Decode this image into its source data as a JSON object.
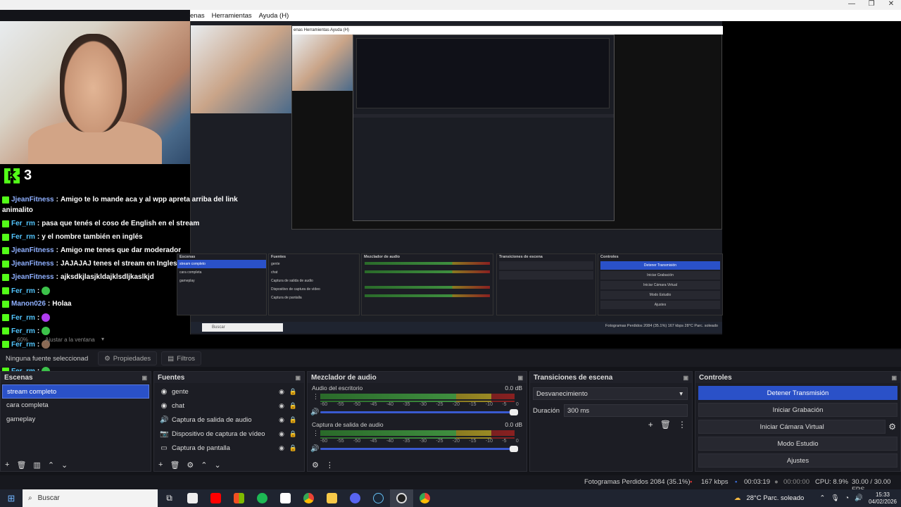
{
  "window": {
    "menu": [
      "enas",
      "Herramientas",
      "Ayuda (H)"
    ],
    "controls": [
      "—",
      "❐",
      "✕"
    ]
  },
  "chat": {
    "count": "3",
    "messages": [
      {
        "user": "JjeanFitness",
        "text": "Amigo te lo mande aca y al wpp apreta arriba del link",
        "cont": "animalito",
        "color": "#8fb0ff"
      },
      {
        "user": "Fer_rm",
        "text": "pasa que tenés el coso de English en el stream",
        "color": "#53c6ff"
      },
      {
        "user": "Fer_rm",
        "text": "y el nombre también en inglés",
        "color": "#53c6ff"
      },
      {
        "user": "JjeanFitness",
        "text": "Amigo me tenes que dar moderador",
        "color": "#8fb0ff"
      },
      {
        "user": "JjeanFitness",
        "text": "JAJAJAJ tenes el stream en Ingles",
        "color": "#8fb0ff"
      },
      {
        "user": "JjeanFitness",
        "text": "ajksdkjlasjkldajklsdljkaslkjd",
        "color": "#8fb0ff"
      },
      {
        "user": "Fer_rm",
        "text": "",
        "emote": "#3cc24a",
        "color": "#53c6ff"
      },
      {
        "user": "Manon026",
        "text": "Holaa",
        "color": "#8fb0ff"
      },
      {
        "user": "Fer_rm",
        "text": "",
        "emote": "#b03cf0",
        "color": "#53c6ff"
      },
      {
        "user": "Fer_rm",
        "text": "",
        "emote": "#3cc24a",
        "color": "#53c6ff"
      },
      {
        "user": "Fer_rm",
        "text": "",
        "emote": "#8a6a55",
        "color": "#53c6ff"
      },
      {
        "user": "Fer_rm",
        "text": "",
        "emote": "#3cc24a",
        "color": "#53c6ff"
      },
      {
        "user": "Fer_rm",
        "text": "",
        "emote": "#3cc24a",
        "color": "#53c6ff"
      },
      {
        "user": "Fer_rm",
        "text": "",
        "emote": "#3cc24a",
        "color": "#53c6ff"
      }
    ]
  },
  "zoom": {
    "value": "60%",
    "fit": "Ajustar a la ventana"
  },
  "toolbar": {
    "no_source": "Ninguna fuente seleccionad",
    "properties": "Propiedades",
    "filters": "Filtros"
  },
  "scenes": {
    "title": "Escenas",
    "items": [
      "stream completo",
      "cara completa",
      "gameplay"
    ]
  },
  "sources": {
    "title": "Fuentes",
    "items": [
      {
        "label": "gente",
        "icon": "web-icon"
      },
      {
        "label": "chat",
        "icon": "web-icon"
      },
      {
        "label": "Captura de salida de audio",
        "icon": "speaker-icon"
      },
      {
        "label": "Dispositivo de captura de vídeo",
        "icon": "camera-icon"
      },
      {
        "label": "Captura de pantalla",
        "icon": "monitor-icon"
      }
    ]
  },
  "mixer": {
    "title": "Mezclador de audio",
    "channels": [
      {
        "name": "Audio del escritorio",
        "db": "0.0 dB"
      },
      {
        "name": "Captura de salida de audio",
        "db": "0.0 dB"
      }
    ],
    "ticks": [
      "-60",
      "-55",
      "-50",
      "-45",
      "-40",
      "-35",
      "-30",
      "-25",
      "-20",
      "-15",
      "-10",
      "-5",
      "0"
    ]
  },
  "transitions": {
    "title": "Transiciones de escena",
    "selected": "Desvanecimiento",
    "duration_label": "Duración",
    "duration_value": "300 ms"
  },
  "controls": {
    "title": "Controles",
    "buttons": [
      "Detener Transmisión",
      "Iniciar Grabación",
      "Iniciar Cámara Virtual",
      "Modo Estudio",
      "Ajustes"
    ]
  },
  "status": {
    "dropped": "Fotogramas Perdidos 2084 (35.1%)",
    "kbps": "167 kbps",
    "live": "00:03:19",
    "rec": "00:00:00",
    "cpu": "CPU: 8.9%",
    "fps": "30.00 / 30.00 FPS"
  },
  "taskbar": {
    "search": "Buscar",
    "weather": "28°C  Parc. soleado",
    "time": "15:33",
    "date": "04/02/2026"
  },
  "nested": {
    "menu": "enas   Herramientas   Ayuda (H)",
    "scenes": [
      "stream completo",
      "cara completa",
      "gameplay"
    ],
    "sources": [
      "gente",
      "chat",
      "Captura de salida de audio",
      "Dispositivo de captura de vídeo",
      "Captura de pantalla"
    ],
    "controls": [
      "Detener Transmisión",
      "Iniciar Grabación",
      "Iniciar Cámara Virtual",
      "Modo Estudio",
      "Ajustes"
    ],
    "mixer_title": "Mezclador de audio",
    "trans_title": "Transiciones de escena",
    "scenes_title": "Escenas",
    "sources_title": "Fuentes",
    "controls_title": "Controles",
    "search": "Buscar",
    "status": "Fotogramas Perdidos 2084 (35.1%)    167 kbps    28°C  Parc. soleado"
  }
}
